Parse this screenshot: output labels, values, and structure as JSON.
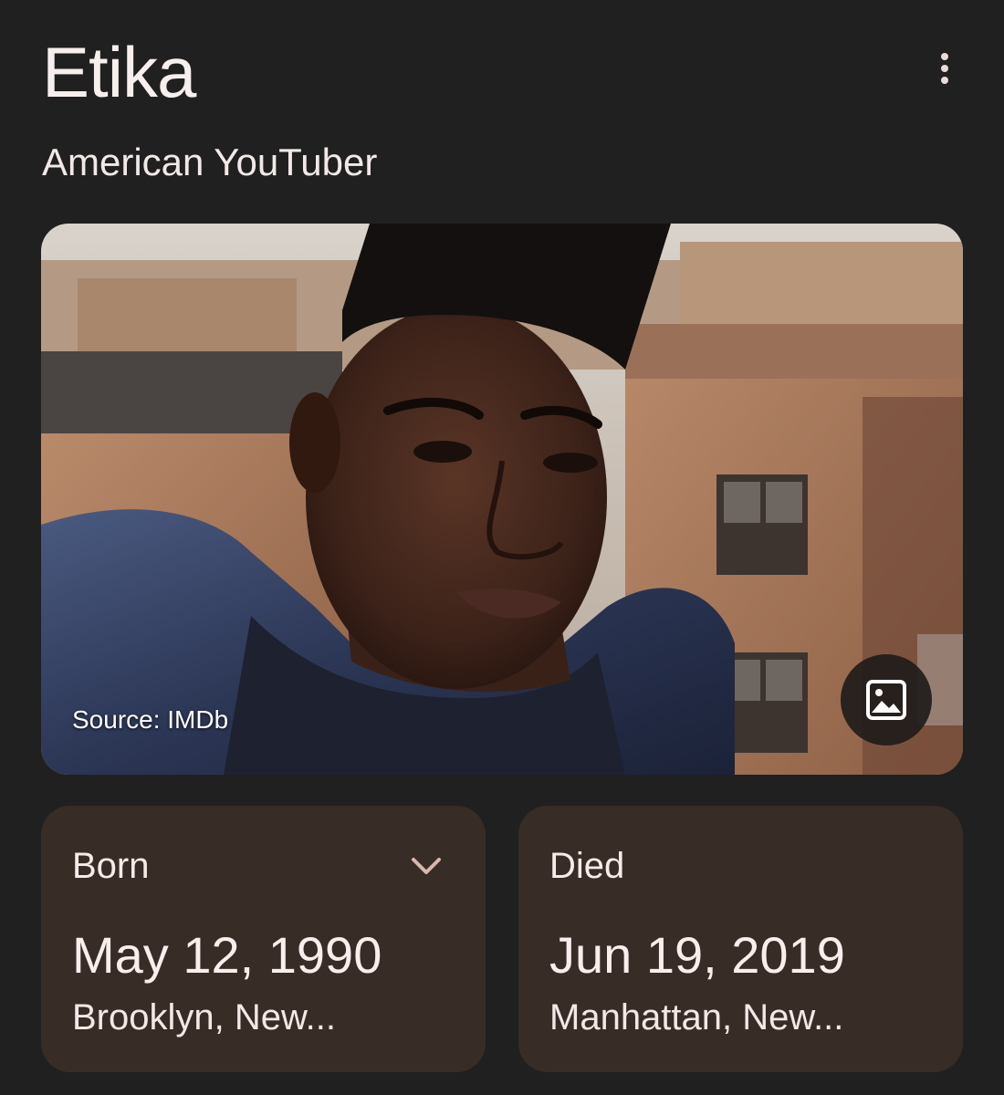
{
  "header": {
    "title": "Etika",
    "subtitle": "American YouTuber",
    "more_icon": "more-vert-icon"
  },
  "photo": {
    "source_label": "Source: IMDb",
    "images_icon": "image-icon"
  },
  "facts": {
    "born": {
      "label": "Born",
      "date": "May 12, 1990",
      "place": "Brooklyn, New...",
      "expand_icon": "chevron-down-icon"
    },
    "died": {
      "label": "Died",
      "date": "Jun 19, 2019",
      "place": "Manhattan, New..."
    }
  },
  "colors": {
    "background": "#202020",
    "card": "#382c27",
    "text": "#f5ecea",
    "accent": "#d9b8ac"
  }
}
